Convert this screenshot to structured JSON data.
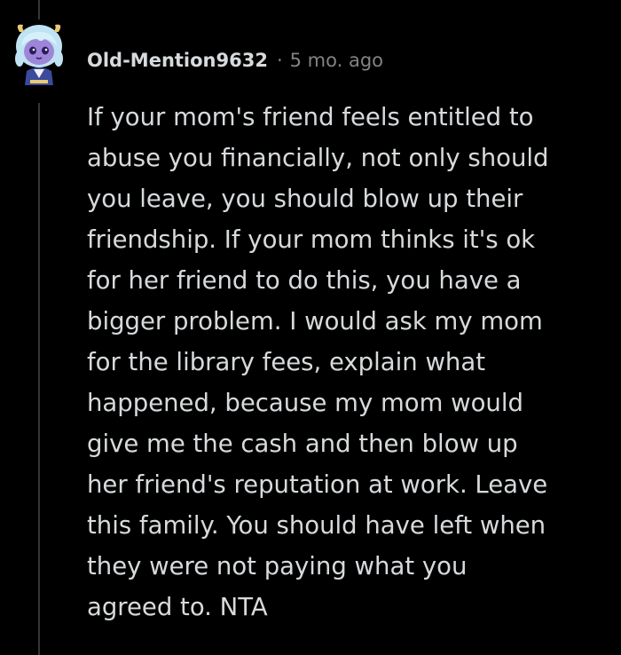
{
  "comment": {
    "author": "Old-Mention9632",
    "separator": "·",
    "age": "5 mo. ago",
    "avatar_icon": "snoo-avatar-icon",
    "body": "If your mom's friend feels entitled to\nabuse you financially, not only should\nyou leave, you should blow up their\nfriendship. If your mom thinks it's ok\nfor her friend to do this, you have a\nbigger problem. I would ask my mom\nfor the library fees, explain what\nhappened, because my mom would\ngive me the cash and then blow up\nher friend's reputation at work. Leave\nthis family. You should have left when\nthey were not paying what you\nagreed to. NTA"
  },
  "colors": {
    "background": "#000000",
    "text": "#d7dadc",
    "meta": "#818384",
    "thread_line": "#343536"
  }
}
